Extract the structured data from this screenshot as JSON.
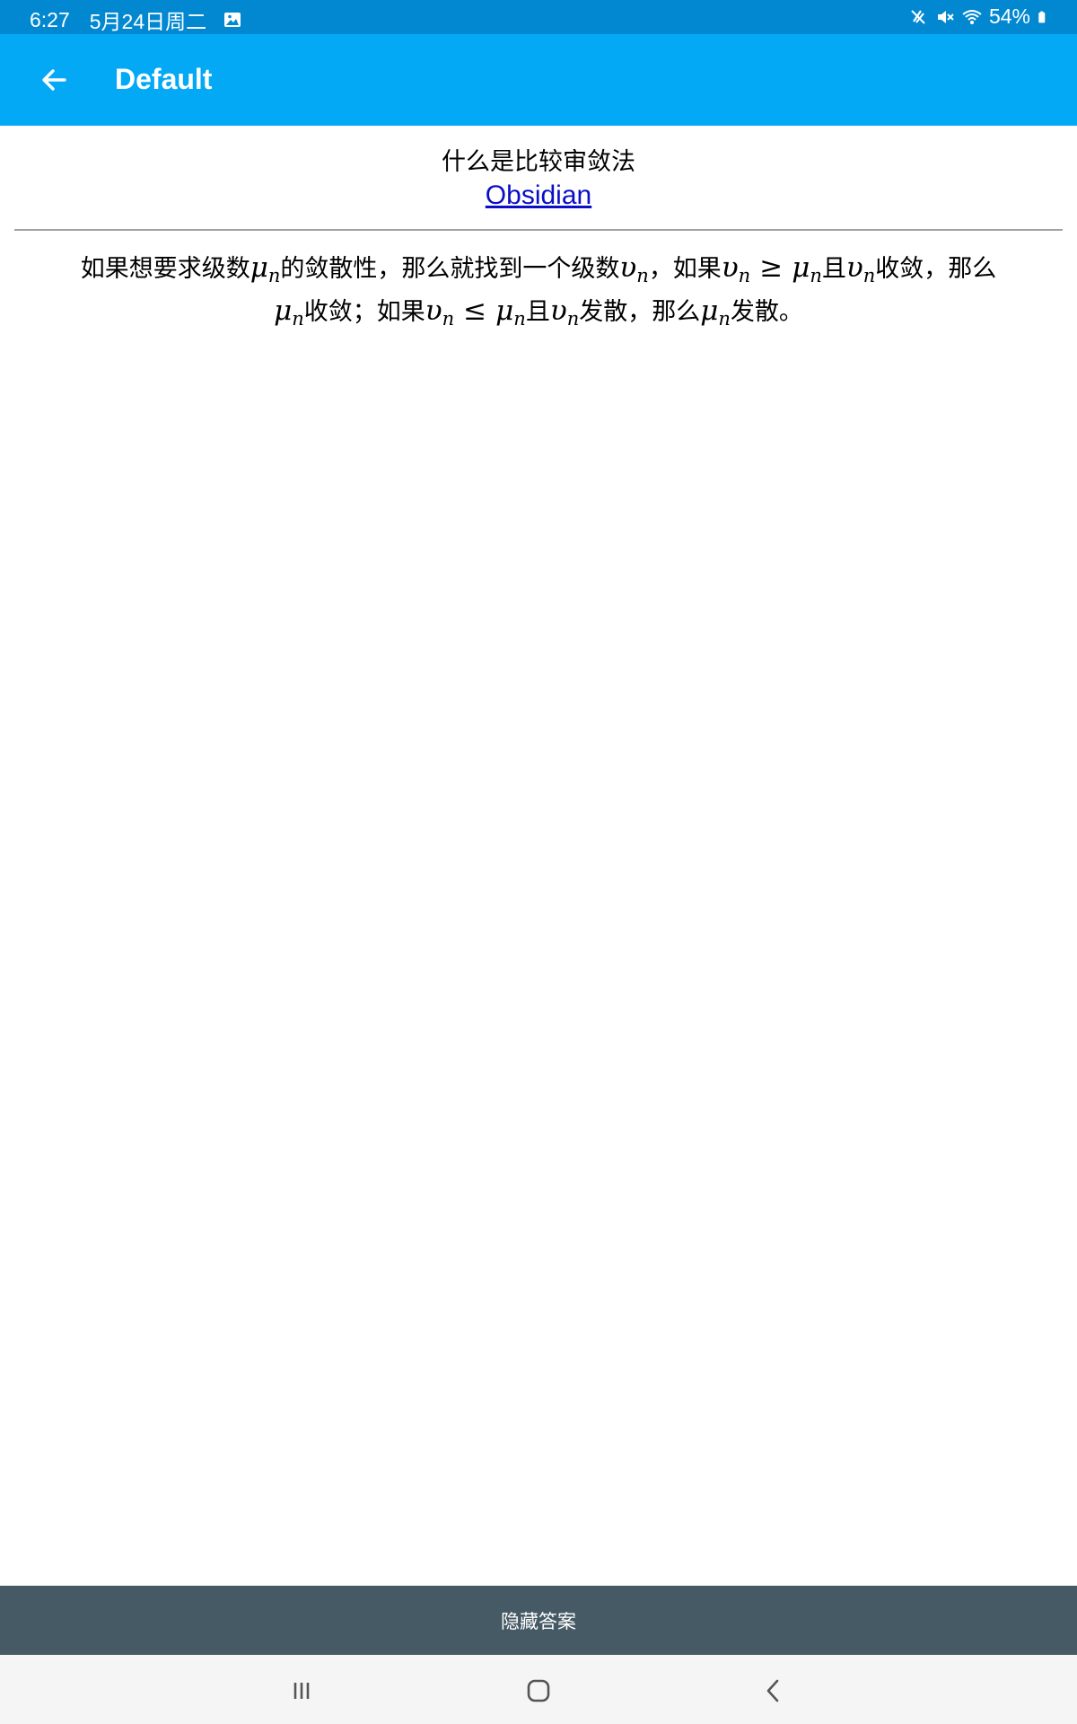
{
  "status_bar": {
    "time": "6:27",
    "date": "5月24日周二",
    "battery": "54%",
    "icons": [
      "image-icon",
      "no-sound-icon",
      "mute-icon",
      "wifi-icon",
      "battery-icon"
    ]
  },
  "app_bar": {
    "title": "Default",
    "back_icon": "arrow-left-icon"
  },
  "card": {
    "question": "什么是比较审敛法",
    "source_link": "Obsidian",
    "answer": {
      "line1": {
        "t1": "如果想要求级数",
        "m1_base": "μ",
        "m1_sub": "n",
        "t2": "的敛散性，那么就找到一个级数",
        "m2_base": "υ",
        "m2_sub": "n",
        "t3": "，如果",
        "m3_base": "υ",
        "m3_sub": "n",
        "rel1": "≥",
        "m4_base": "μ",
        "m4_sub": "n",
        "t4": "且",
        "m5_base": "υ",
        "m5_sub": "n",
        "t5": "收敛，那么"
      },
      "line2": {
        "m1_base": "μ",
        "m1_sub": "n",
        "t1": "收敛；如果",
        "m2_base": "υ",
        "m2_sub": "n",
        "rel1": "≤",
        "m3_base": "μ",
        "m3_sub": "n",
        "t2": "且",
        "m4_base": "υ",
        "m4_sub": "n",
        "t3": "发散，那么",
        "m5_base": "μ",
        "m5_sub": "n",
        "t4": "发散。"
      }
    }
  },
  "hide_answer_button": "隐藏答案",
  "nav_bar": {
    "icons": [
      "recent-apps-icon",
      "home-icon",
      "back-icon"
    ]
  },
  "colors": {
    "status_bar": "#0288d1",
    "app_bar": "#03a9f4",
    "hide_bar": "#455a64",
    "link": "#0a0ec6"
  }
}
